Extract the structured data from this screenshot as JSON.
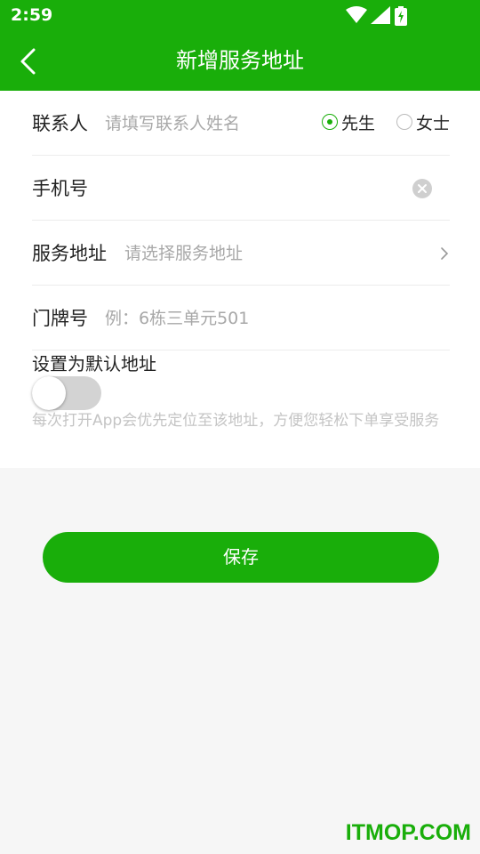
{
  "status_bar": {
    "time": "2:59"
  },
  "app_bar": {
    "title": "新增服务地址"
  },
  "contact": {
    "label": "联系人",
    "placeholder": "请填写联系人姓名",
    "options": [
      {
        "label": "先生",
        "selected": true
      },
      {
        "label": "女士",
        "selected": false
      }
    ]
  },
  "phone": {
    "label": "手机号",
    "value": ""
  },
  "address": {
    "label": "服务地址",
    "placeholder": "请选择服务地址"
  },
  "doorplate": {
    "label": "门牌号",
    "placeholder": "例：6栋三单元501"
  },
  "default_address": {
    "title": "设置为默认地址",
    "enabled": false,
    "hint": "每次打开App会优先定位至该地址，方便您轻松下单享受服务"
  },
  "save_label": "保存",
  "watermark": "ITMOP.COM",
  "colors": {
    "accent": "#19ae0a",
    "placeholder": "#a8a8a8"
  }
}
